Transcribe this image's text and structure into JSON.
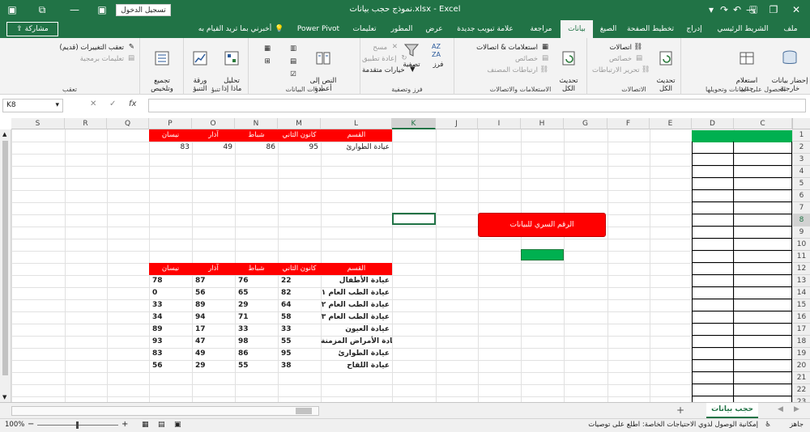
{
  "window": {
    "title": "نموذج حجب بيانات.xlsx - Excel",
    "signin_label": "تسجيل الدخول",
    "minimize": "—",
    "restore": "❐",
    "close": "✕",
    "ribbon_display": "▣"
  },
  "tabs": {
    "file": "ملف",
    "home": "الشريط الرئيسي",
    "insert": "إدراج",
    "page_layout": "تخطيط الصفحة",
    "formulas": "الصيغ",
    "data": "بيانات",
    "review": "مراجعة",
    "new_tab": "علامة تبويب جديدة",
    "view": "عرض",
    "developer": "المطور",
    "help": "تعليمات",
    "power_pivot": "Power Pivot",
    "tell_me": "أخبرني بما تريد القيام به",
    "share": "مشاركة"
  },
  "ribbon": {
    "get_external_data": "إحضار بيانات\nخارجية",
    "new_query": "استعلام\nجديد",
    "get_transform_label": "الحصول على البيانات وتحويلها",
    "connections": "اتصالات",
    "properties": "خصائص",
    "edit_links": "تحرير الارتباطات",
    "refresh_all_1": "تحديث\nالكل",
    "connections_group_label": "الاتصالات",
    "queries_connections": "استعلامات & اتصالات",
    "properties2": "خصائص",
    "edit_links2": "ارتباطات المصنف",
    "refresh_all_2": "تحديث\nالكل",
    "queries_group_label": "الاستعلامات والاتصالات",
    "sort": "فرز",
    "filter": "تصفية",
    "clear": "مسح",
    "reapply": "إعادة تطبيق",
    "advanced": "خيارات متقدمة",
    "sort_filter_label": "فرز وتصفية",
    "text_to_columns": "النص إلى\nأعمدة",
    "data_tools_label": "أدوات البيانات",
    "what_if": "تحليل\nماذا إذا",
    "forecast_sheet": "ورقة\nالتنبؤ",
    "forecast_label": "تنبؤ",
    "group": "تجميع\nوتلخيص",
    "track_changes": "تعقب التغييرات (قديم)",
    "program_notes": "تعليمات برمجية",
    "track_label": "تعقب"
  },
  "formula_bar": {
    "name_box": "K8",
    "fx": "fx",
    "value": ""
  },
  "columns": [
    "C",
    "D",
    "E",
    "F",
    "G",
    "H",
    "I",
    "J",
    "K",
    "L",
    "M",
    "N",
    "O",
    "P",
    "Q",
    "R",
    "S"
  ],
  "rows": [
    "1",
    "2",
    "3",
    "4",
    "5",
    "6",
    "7",
    "8",
    "9",
    "10",
    "11",
    "12",
    "13",
    "14",
    "15",
    "16",
    "17",
    "18",
    "19",
    "20",
    "21",
    "22",
    "23"
  ],
  "table1": {
    "headers": [
      "القسم",
      "كانون الثاني",
      "شباط",
      "آذار",
      "نيسان"
    ],
    "row": {
      "name": "عيادة الطوارئ",
      "values": [
        "95",
        "86",
        "49",
        "83"
      ]
    }
  },
  "secret_button": "الرقم السري للبيانات",
  "table2": {
    "headers": [
      "القسم",
      "كانون الثاني",
      "شباط",
      "آذار",
      "نيسان"
    ],
    "rows": [
      {
        "name": "عيادة الأطفال",
        "values": [
          "22",
          "76",
          "87",
          "78"
        ]
      },
      {
        "name": "عيادة الطب العام ١",
        "values": [
          "82",
          "65",
          "56",
          "0"
        ]
      },
      {
        "name": "عيادة الطب العام ٢",
        "values": [
          "64",
          "29",
          "89",
          "33"
        ]
      },
      {
        "name": "عيادة الطب العام ٣",
        "values": [
          "58",
          "71",
          "94",
          "34"
        ]
      },
      {
        "name": "عيادة العيون",
        "values": [
          "33",
          "33",
          "17",
          "89"
        ]
      },
      {
        "name": "عيادة الأمراض المزمنة",
        "values": [
          "55",
          "98",
          "47",
          "93"
        ]
      },
      {
        "name": "عيادة الطوارئ",
        "values": [
          "95",
          "86",
          "49",
          "83"
        ]
      },
      {
        "name": "عيادة اللقاح",
        "values": [
          "38",
          "55",
          "29",
          "56"
        ]
      }
    ]
  },
  "sheet_tabs": {
    "active": "حجب بيانات",
    "add": "+"
  },
  "status": {
    "ready": "جاهز",
    "accessibility": "إمكانية الوصول لذوي الاحتياجات الخاصة: اطلع على توصيات",
    "zoom": "100%"
  },
  "colors": {
    "excel_green": "#217346",
    "header_red": "#ff0000",
    "selected_green": "#00b050"
  }
}
